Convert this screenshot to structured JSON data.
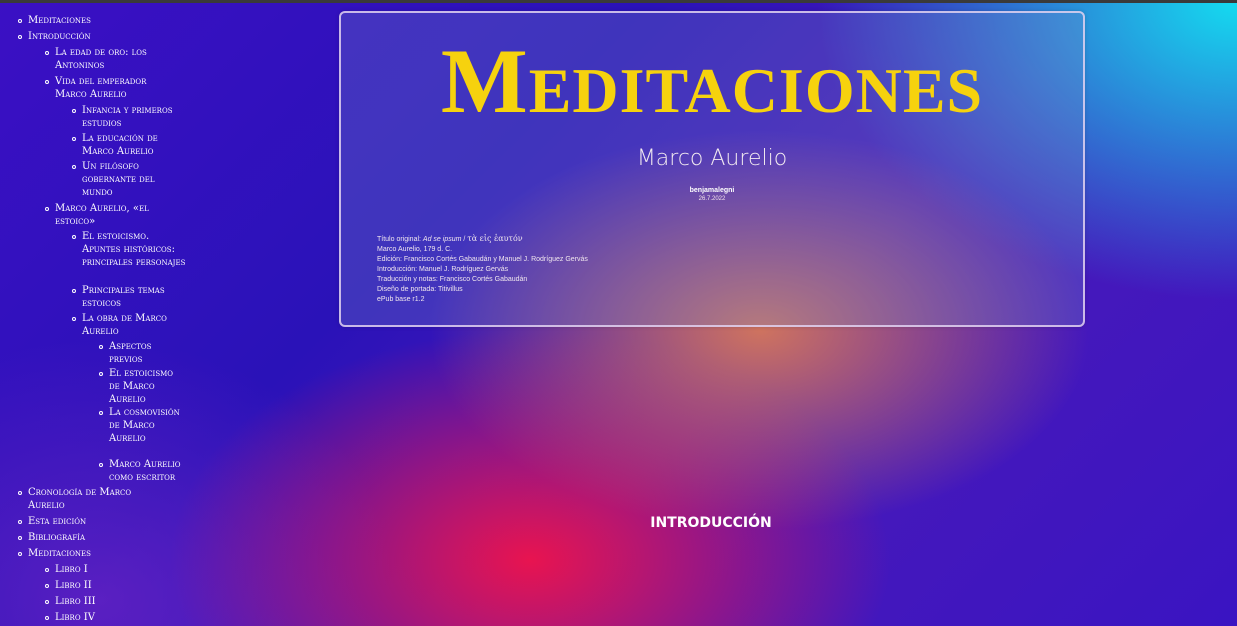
{
  "toc": {
    "items": [
      {
        "label": "Meditaciones"
      },
      {
        "label": "Introducción"
      },
      {
        "label": "La edad de oro: los Antoninos"
      },
      {
        "label": "Vida del emperador Marco Aurelio"
      },
      {
        "label": "Infancia y primeros estudios"
      },
      {
        "label": "La educación de Marco Aurelio"
      },
      {
        "label": "Un filósofo gobernante del mundo"
      },
      {
        "label": "Marco Aurelio, «el estoico»"
      },
      {
        "label": "El estoicismo. Apuntes históricos: principales personajes"
      },
      {
        "label": "Principales temas estoicos"
      },
      {
        "label": "La obra de Marco Aurelio"
      },
      {
        "label": "Aspectos previos"
      },
      {
        "label": "El estoicismo de Marco Aurelio"
      },
      {
        "label": "La cosmovisión de Marco Aurelio"
      },
      {
        "label": "Marco Aurelio como escritor"
      },
      {
        "label": "Cronología de Marco Aurelio"
      },
      {
        "label": "Esta edición"
      },
      {
        "label": "Bibliografía"
      },
      {
        "label": "Meditaciones"
      },
      {
        "label": "Libro I"
      },
      {
        "label": "Libro II"
      },
      {
        "label": "Libro III"
      },
      {
        "label": "Libro IV"
      }
    ]
  },
  "cover": {
    "title": "Meditaciones",
    "author": "Marco Aurelio",
    "editor": "benjamalegni",
    "date": "26.7.2022",
    "credits": {
      "original_title_label": "Título original:",
      "original_title_latin": "Ad se ipsum",
      "original_title_sep": "/",
      "original_title_greek": "τὰ εἰς ἑαυτόν",
      "line2": "Marco Aurelio, 179 d. C.",
      "line3": "Edición: Francisco Cortés Gabaudán y Manuel J. Rodríguez Gervás",
      "line4": "Introducción: Manuel J. Rodríguez Gervás",
      "line5": "Traducción y notas: Francisco Cortés Gabaudán",
      "line6": "Diseño de portada: Titivillus",
      "line7": "ePub base r1.2"
    }
  },
  "section_heading": "INTRODUCCIÓN",
  "colors": {
    "title": "#f6d20e",
    "background_primary": "#3b10c4",
    "accent_cyan": "#14dcf0",
    "accent_pink": "#e81450"
  }
}
